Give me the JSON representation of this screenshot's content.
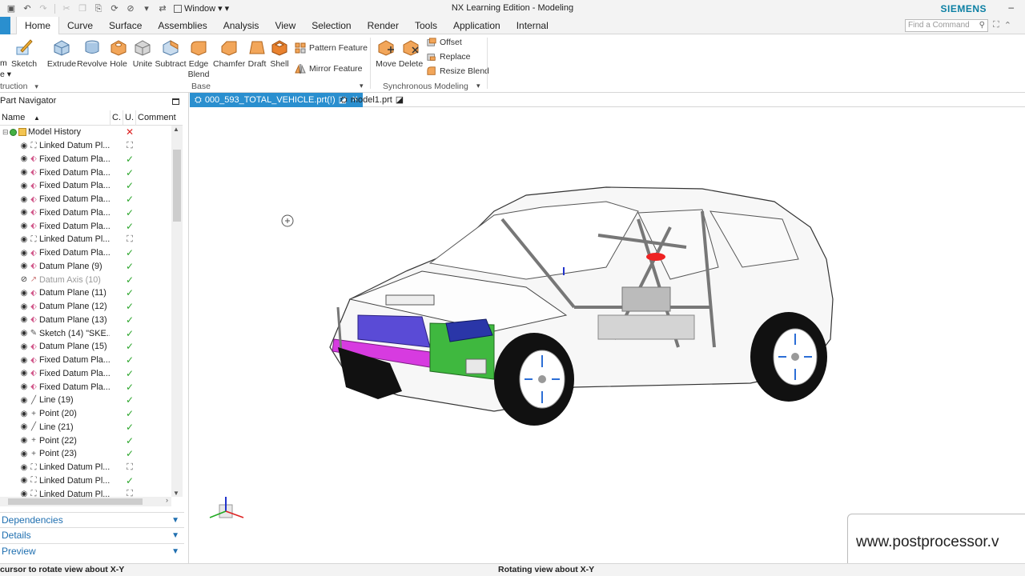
{
  "titlebar": {
    "window_menu": "Window",
    "app_title": "NX Learning Edition - Modeling",
    "brand": "SIEMENS"
  },
  "menu_tabs": [
    "Home",
    "Curve",
    "Surface",
    "Assemblies",
    "Analysis",
    "View",
    "Selection",
    "Render",
    "Tools",
    "Application",
    "Internal"
  ],
  "active_tab": "Home",
  "command_search": {
    "placeholder": "Find a Command"
  },
  "ribbon": {
    "partial_left": {
      "top": "m",
      "mid": "e",
      "group": "truction"
    },
    "sketch": "Sketch",
    "base_buttons": {
      "extrude": "Extrude",
      "revolve": "Revolve",
      "hole": "Hole",
      "unite": "Unite",
      "subtract": "Subtract",
      "edge_blend_1": "Edge",
      "edge_blend_2": "Blend",
      "chamfer": "Chamfer",
      "draft": "Draft",
      "shell": "Shell",
      "pattern_feature": "Pattern Feature",
      "mirror_feature": "Mirror Feature"
    },
    "base_group_label": "Base",
    "sync_buttons": {
      "move": "Move",
      "delete": "Delete",
      "offset": "Offset",
      "replace": "Replace",
      "resize_blend": "Resize Blend"
    },
    "sync_group_label": "Synchronous Modeling"
  },
  "navigator": {
    "title": "Part Navigator",
    "columns": {
      "name": "Name",
      "c": "C.",
      "u": "U.",
      "comment": "Comment"
    },
    "model_history": "Model History",
    "items": [
      {
        "label": "Linked Datum Pl...",
        "status": "link",
        "icon": "linked"
      },
      {
        "label": "Fixed Datum Pla...",
        "status": "ok",
        "icon": "plane"
      },
      {
        "label": "Fixed Datum Pla...",
        "status": "ok",
        "icon": "plane"
      },
      {
        "label": "Fixed Datum Pla...",
        "status": "ok",
        "icon": "plane"
      },
      {
        "label": "Fixed Datum Pla...",
        "status": "ok",
        "icon": "plane"
      },
      {
        "label": "Fixed Datum Pla...",
        "status": "ok",
        "icon": "plane"
      },
      {
        "label": "Fixed Datum Pla...",
        "status": "ok",
        "icon": "plane"
      },
      {
        "label": "Linked Datum Pl...",
        "status": "link",
        "icon": "linked"
      },
      {
        "label": "Fixed Datum Pla...",
        "status": "ok",
        "icon": "plane"
      },
      {
        "label": "Datum Plane (9)",
        "status": "ok",
        "icon": "plane"
      },
      {
        "label": "Datum Axis (10)",
        "status": "ok",
        "icon": "axis",
        "dim": true
      },
      {
        "label": "Datum Plane (11)",
        "status": "ok",
        "icon": "plane"
      },
      {
        "label": "Datum Plane (12)",
        "status": "ok",
        "icon": "plane"
      },
      {
        "label": "Datum Plane (13)",
        "status": "ok",
        "icon": "plane"
      },
      {
        "label": "Sketch (14) \"SKE...",
        "status": "ok",
        "icon": "sketch"
      },
      {
        "label": "Datum Plane (15)",
        "status": "ok",
        "icon": "plane"
      },
      {
        "label": "Fixed Datum Pla...",
        "status": "ok",
        "icon": "plane"
      },
      {
        "label": "Fixed Datum Pla...",
        "status": "ok",
        "icon": "plane"
      },
      {
        "label": "Fixed Datum Pla...",
        "status": "ok",
        "icon": "plane"
      },
      {
        "label": "Line (19)",
        "status": "ok",
        "icon": "line"
      },
      {
        "label": "Point (20)",
        "status": "ok",
        "icon": "point"
      },
      {
        "label": "Line (21)",
        "status": "ok",
        "icon": "line"
      },
      {
        "label": "Point (22)",
        "status": "ok",
        "icon": "point"
      },
      {
        "label": "Point (23)",
        "status": "ok",
        "icon": "point"
      },
      {
        "label": "Linked Datum Pl...",
        "status": "link",
        "icon": "linked"
      },
      {
        "label": "Linked Datum Pl...",
        "status": "ok",
        "icon": "linked"
      },
      {
        "label": "Linked Datum Pl...",
        "status": "link",
        "icon": "linked"
      }
    ],
    "panels": {
      "dependencies": "Dependencies",
      "details": "Details",
      "preview": "Preview"
    }
  },
  "doc_tabs": [
    {
      "label": "000_593_TOTAL_VEHICLE.prt(!)",
      "active": true
    },
    {
      "label": "model1.prt",
      "active": false
    }
  ],
  "watermark": "www.postprocessor.v",
  "status": {
    "left": "cursor to rotate view about X-Y",
    "center": "Rotating view about X-Y"
  },
  "colors": {
    "accent": "#2a8fcf",
    "ok": "#2aa52a",
    "error": "#dd2222",
    "brand": "#0b7fa3"
  }
}
